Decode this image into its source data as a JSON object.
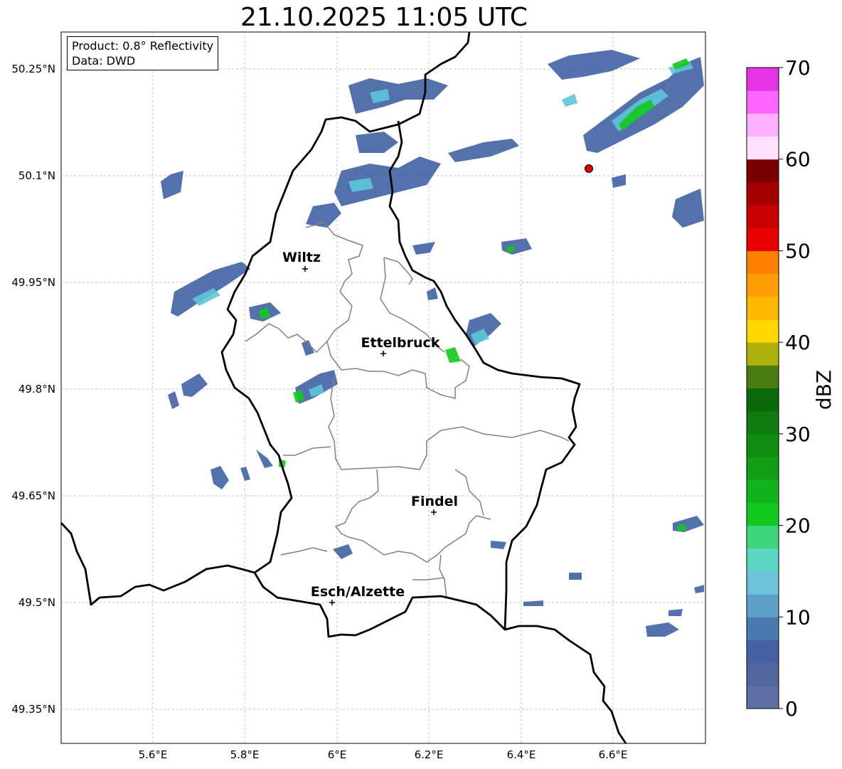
{
  "title": "21.10.2025 11:05 UTC",
  "info": {
    "product": "Product: 0.8° Reflectivity",
    "data": "Data: DWD"
  },
  "axes": {
    "lat_ticks": [
      "50.25°N",
      "50.1°N",
      "49.95°N",
      "49.8°N",
      "49.65°N",
      "49.5°N",
      "49.35°N"
    ],
    "lon_ticks": [
      "5.6°E",
      "5.8°E",
      "6°E",
      "6.2°E",
      "6.4°E",
      "6.6°E"
    ]
  },
  "cities": [
    {
      "name": "Wiltz"
    },
    {
      "name": "Ettelbruck"
    },
    {
      "name": "Findel"
    },
    {
      "name": "Esch/Alzette"
    }
  ],
  "colorbar": {
    "label": "dBZ",
    "ticks": [
      "0",
      "10",
      "20",
      "30",
      "40",
      "50",
      "60",
      "70"
    ],
    "colors": [
      "#5e6fa3",
      "#52679f",
      "#4560a3",
      "#4a7ab0",
      "#5da0c9",
      "#6bc4dc",
      "#5cd6c2",
      "#3ed67a",
      "#12c81e",
      "#12b41e",
      "#0f9e14",
      "#0f8c12",
      "#0f7a10",
      "#0a6a0c",
      "#4a7a10",
      "#b0b00a",
      "#ffd700",
      "#ffb800",
      "#ff9e00",
      "#ff8000",
      "#e60000",
      "#c80000",
      "#a50000",
      "#7a0000",
      "#ffe0ff",
      "#ffb0ff",
      "#ff66ff",
      "#e632e6"
    ]
  },
  "radar_marker": {
    "color": "#e00000"
  }
}
